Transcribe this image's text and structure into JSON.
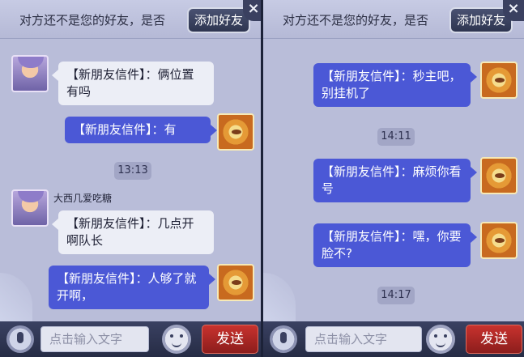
{
  "left": {
    "header_text": "对方还不是您的好友，是否",
    "add_friend_label": "添加好友",
    "close_label": "×",
    "messages": [
      {
        "text": "【新朋友信件】：俩位置有吗",
        "direction": "in"
      },
      {
        "text": "【新朋友信件】：有",
        "direction": "out"
      },
      {
        "time": "13:13"
      },
      {
        "sender": "大西几爱吃糖",
        "text": "【新朋友信件】：几点开啊队长",
        "direction": "in"
      },
      {
        "text": "【新朋友信件】：人够了就开啊，",
        "direction": "out"
      }
    ],
    "input_placeholder": "点击输入文字",
    "send_label": "发送"
  },
  "right": {
    "header_text": "对方还不是您的好友，是否",
    "add_friend_label": "添加好友",
    "close_label": "×",
    "messages": [
      {
        "text": "【新朋友信件】：秒主吧，别挂机了",
        "direction": "out"
      },
      {
        "time": "14:11"
      },
      {
        "text": "【新朋友信件】：麻烦你看号",
        "direction": "out"
      },
      {
        "text": "【新朋友信件】：嘿，你要脸不?",
        "direction": "out"
      },
      {
        "time": "14:17"
      }
    ],
    "input_placeholder": "点击输入文字",
    "send_label": "发送"
  },
  "colors": {
    "bubble_out": "#4b58d6",
    "bubble_in": "#eceef6",
    "send_button": "#c8322e",
    "panel_bg": "#b9bdd9"
  },
  "icons": {
    "mic": "microphone-icon",
    "emoji": "emoji-face-icon",
    "close": "close-icon"
  }
}
